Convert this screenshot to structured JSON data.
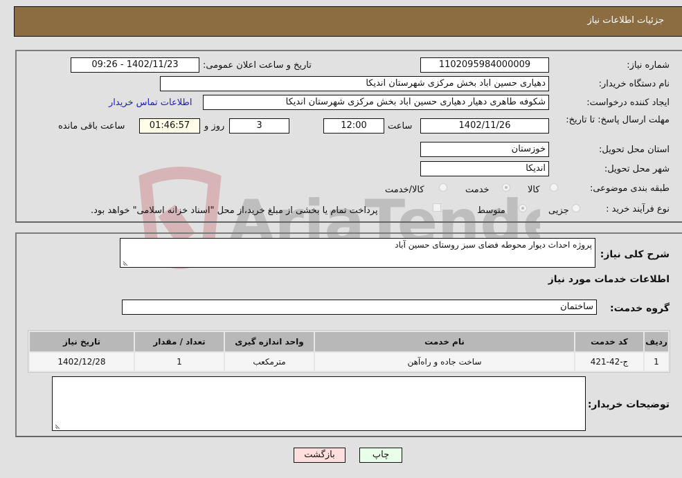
{
  "header": {
    "title": "جزئیات اطلاعات نیاز"
  },
  "fields": {
    "need_number": {
      "label": "شماره نیاز:",
      "value": "1102095984000009"
    },
    "announce_datetime": {
      "label": "تاریخ و ساعت اعلان عمومی:",
      "value": "1402/11/23 - 09:26"
    },
    "buyer_org": {
      "label": "نام دستگاه خریدار:",
      "value": "دهیاری حسین اباد بخش مرکزی شهرستان اندیکا"
    },
    "requester": {
      "label": "ایجاد کننده درخواست:",
      "value": "شکوفه طاهری دهیار دهیاری حسین اباد بخش مرکزی شهرستان اندیکا"
    },
    "buyer_contact_link": "اطلاعات تماس خریدار",
    "deadline": {
      "label": "مهلت ارسال پاسخ: تا تاریخ:",
      "date": "1402/11/26",
      "time_label": "ساعت",
      "time": "12:00",
      "days": "3",
      "days_label": "روز و",
      "remaining": "01:46:57",
      "remaining_label": "ساعت باقی مانده"
    },
    "province": {
      "label": "استان محل تحویل:",
      "value": "خوزستان"
    },
    "city": {
      "label": "شهر محل تحویل:",
      "value": "اندیکا"
    },
    "category": {
      "label": "طبقه بندی موضوعی:",
      "options": [
        "کالا",
        "خدمت",
        "کالا/خدمت"
      ],
      "selected": "خدمت"
    },
    "purchase_type": {
      "label": "نوع فرآیند خرید :",
      "options": [
        "جزیی",
        "متوسط"
      ],
      "selected": "متوسط",
      "treasury_note": "پرداخت تمام یا بخشی از مبلغ خرید،از محل \"اسناد خزانه اسلامی\" خواهد بود."
    }
  },
  "description": {
    "label": "شرح کلی نیاز:",
    "value": "پروژه احداث دیوار محوطه فضای سبز روستای حسین آباد"
  },
  "services_section_title": "اطلاعات خدمات مورد نیاز",
  "service_group": {
    "label": "گروه خدمت:",
    "value": "ساختمان"
  },
  "table": {
    "headers": [
      "ردیف",
      "کد خدمت",
      "نام خدمت",
      "واحد اندازه گیری",
      "تعداد / مقدار",
      "تاریخ نیاز"
    ],
    "rows": [
      [
        "1",
        "ج-42-421",
        "ساخت جاده و راه‌آهن",
        "مترمکعب",
        "1",
        "1402/12/28"
      ]
    ]
  },
  "buyer_notes": {
    "label": "توضیحات خریدار:",
    "value": ""
  },
  "buttons": {
    "print": "چاپ",
    "back": "بازگشت"
  },
  "watermark_text": "AriaTender.neT"
}
